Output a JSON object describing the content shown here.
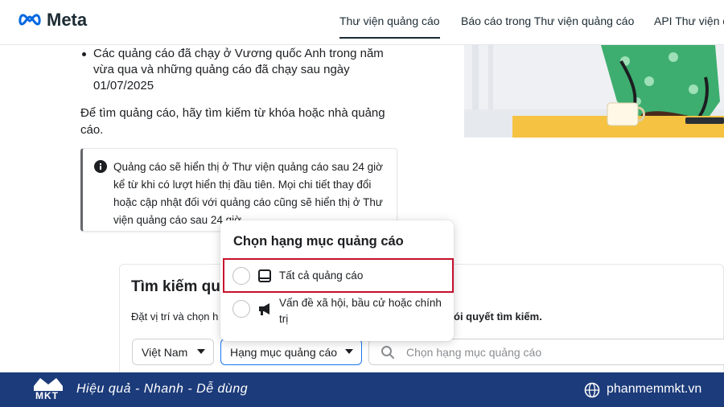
{
  "header": {
    "brand": "Meta",
    "nav": [
      {
        "label": "Thư viện quảng cáo",
        "active": true
      },
      {
        "label": "Báo cáo trong Thư viện quảng cáo",
        "active": false
      },
      {
        "label": "API Thư viện q",
        "active": false
      }
    ]
  },
  "intro": {
    "bullet": "Các quảng cáo đã chạy ở Vương quốc Anh trong năm vừa qua và những quảng cáo đã chạy sau ngày 01/07/2025",
    "paragraph": "Để tìm quảng cáo, hãy tìm kiếm từ khóa hoặc nhà quảng cáo.",
    "notice": "Quảng cáo sẽ hiển thị ở Thư viện quảng cáo sau 24 giờ kể từ khi có lượt hiển thị đầu tiên. Mọi chi tiết thay đổi hoặc cập nhật đối với quảng cáo cũng sẽ hiển thị ở Thư viện quảng cáo sau 24 giờ."
  },
  "search": {
    "title": "Tìm kiếm qu",
    "description_start": "Đặt vị trí và chọn h",
    "description_end": "ói quyết tìm kiếm.",
    "country_select": "Việt Nam",
    "category_select": "Hạng mục quảng cáo",
    "input_placeholder": "Chọn hạng mục quảng cáo"
  },
  "dropdown": {
    "title": "Chọn hạng mục quảng cáo",
    "options": [
      {
        "label": "Tất cả quảng cáo",
        "icon": "ad-tablet-icon",
        "highlighted": true
      },
      {
        "label": "Vấn đề xã hội, bầu cử hoặc chính trị",
        "icon": "megaphone-icon",
        "highlighted": false
      }
    ]
  },
  "footer": {
    "brand": "MKT",
    "slogan": "Hiệu quả - Nhanh - Dễ dùng",
    "website": "phanmemmkt.vn"
  },
  "colors": {
    "accent": "#1877f2",
    "highlight_border": "#c8102e",
    "footer_bg": "#1c3b7a"
  }
}
